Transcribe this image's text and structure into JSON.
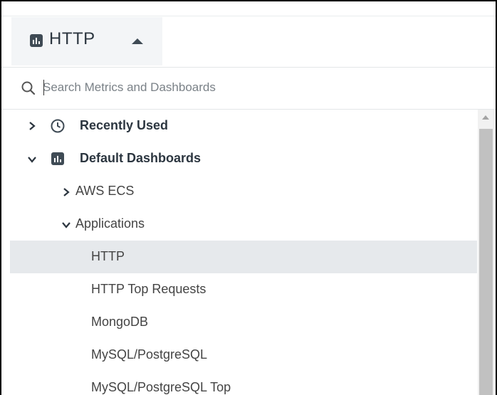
{
  "header": {
    "dashboard_title": "HTTP",
    "dashboard_icon": "bar-chart-icon",
    "toggle_icon": "caret-up-icon"
  },
  "search": {
    "placeholder": "Search Metrics and Dashboards",
    "value": ""
  },
  "tree": {
    "items": [
      {
        "label": "Recently Used",
        "icon": "clock-icon",
        "expanded": false,
        "level": 0
      },
      {
        "label": "Default Dashboards",
        "icon": "bar-chart-icon",
        "expanded": true,
        "level": 0
      },
      {
        "label": "AWS ECS",
        "expanded": false,
        "level": 1
      },
      {
        "label": "Applications",
        "expanded": true,
        "level": 1
      },
      {
        "label": "HTTP",
        "selected": true,
        "level": 2
      },
      {
        "label": "HTTP Top Requests",
        "level": 2
      },
      {
        "label": "MongoDB",
        "level": 2
      },
      {
        "label": "MySQL/PostgreSQL",
        "level": 2
      },
      {
        "label": "MySQL/PostgreSQL Top",
        "level": 2
      }
    ]
  },
  "colors": {
    "accent_dark": "#3f4b55",
    "selected_row": "#e6e9ec",
    "header_button_bg": "#f3f5f7"
  }
}
